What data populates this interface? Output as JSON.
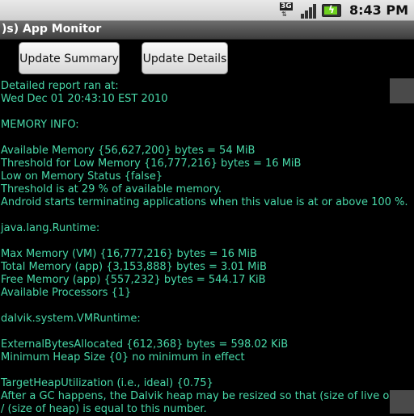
{
  "status_bar": {
    "network_label": "3G",
    "signal_icon": "signal-bars-icon",
    "battery_icon": "battery-charging-icon",
    "time": "8:43 PM"
  },
  "app": {
    "title": ")s) App Monitor"
  },
  "buttons": {
    "update_summary": "Update Summary",
    "update_details": "Update Details"
  },
  "report_lines": [
    "Detailed report ran at:",
    "Wed Dec 01 20:43:10 EST 2010",
    "",
    "MEMORY INFO:",
    "",
    "Available Memory {56,627,200} bytes = 54 MiB",
    "Threshold for Low Memory {16,777,216} bytes = 16 MiB",
    "Low on Memory Status {false}",
    "Threshold is at 29 % of available memory.",
    "Android starts terminating applications when this value is at or above 100 %.",
    "",
    "java.lang.Runtime:",
    "",
    "Max Memory (VM) {16,777,216} bytes = 16 MiB",
    "Total Memory (app) {3,153,888} bytes = 3.01 MiB",
    "Free Memory (app) {557,232} bytes = 544.17 KiB",
    "Available Processors {1}",
    "",
    "dalvik.system.VMRuntime:",
    "",
    "ExternalBytesAllocated {612,368} bytes = 598.02 KiB",
    "Minimum Heap Size {0} no minimum in effect",
    "",
    "TargetHeapUtilization (i.e., ideal) {0.75}",
    "After a GC happens, the Dalvik heap may be resized so that (size of live objects)",
    "/ (size of heap) is equal to this number."
  ]
}
